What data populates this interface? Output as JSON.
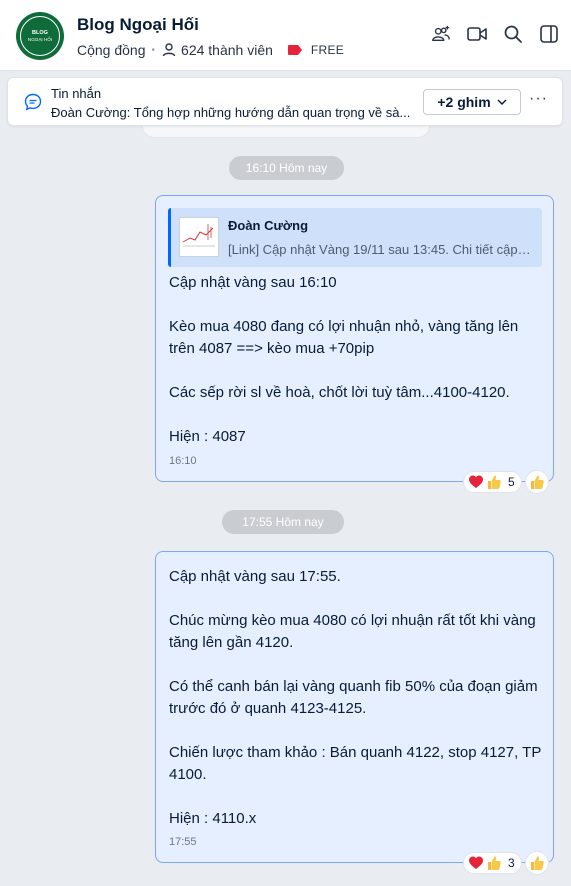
{
  "header": {
    "group_name": "Blog Ngoại Hối",
    "avatar_text": "BLOG NGOẠI HỐI",
    "type": "Cộng đồng",
    "members": "624 thành viên",
    "tier": "FREE"
  },
  "pinned": {
    "title": "Tin nhắn",
    "preview": "Đoàn Cường: Tổng hợp những hướng dẫn quan trọng về sà...",
    "more_label": "+2 ghim"
  },
  "messages": [
    {
      "separator": "16:10 Hôm nay",
      "quote_author": "Đoàn Cường",
      "quote_text": "[Link] Cập nhật Vàng 19/11 sau 13:45. Chi tiết cập n...",
      "text": "Cập nhật vàng sau 16:10\n\nKèo mua 4080 đang có lợi nhuận nhỏ, vàng tăng lên trên 4087 ==> kèo mua +70pip\n\nCác sếp rời sl về hoà, chốt lời tuỳ tâm...4100-4120.\n\nHiện : 4087",
      "time": "16:10",
      "reaction_count": "5"
    },
    {
      "separator": "17:55 Hôm nay",
      "text": "Cập nhật vàng sau 17:55.\n\nChúc mừng kèo mua 4080 có lợi nhuận rất tốt khi vàng tăng lên gần 4120.\n\nCó thể canh bán lại vàng quanh fib 50% của đoạn giảm trước đó ở quanh 4123-4125.\n\nChiến lược tham khảo : Bán quanh 4122, stop 4127, TP 4100.\n\nHiện : 4110.x",
      "time": "17:55",
      "reaction_count": "3"
    }
  ],
  "colors": {
    "accent": "#0068ff",
    "bubble": "#e5efff",
    "bubble_border": "#7aa9ef",
    "background": "#e9ecf0",
    "avatar": "#0f6b3a",
    "free_badge": "#e5243b"
  },
  "icons": [
    "members-icon",
    "video-call-icon",
    "search-icon",
    "sidebar-toggle-icon",
    "chat-icon",
    "heart-icon",
    "thumbs-up-icon",
    "chevron-down-icon",
    "more-icon"
  ]
}
